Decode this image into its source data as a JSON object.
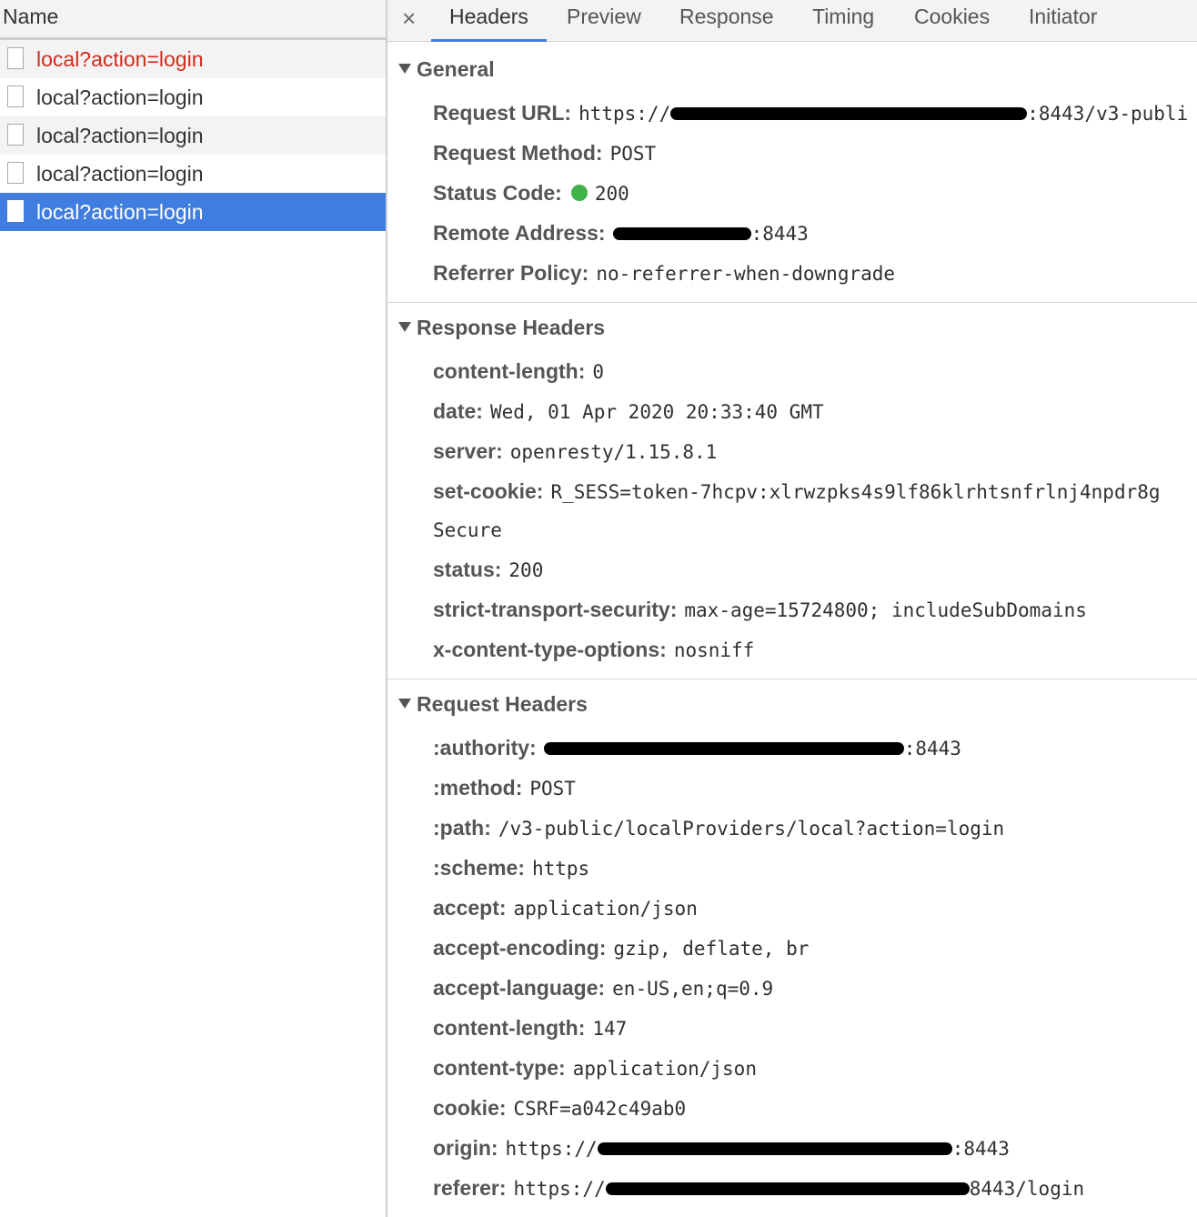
{
  "left_panel": {
    "header": "Name",
    "requests": [
      {
        "label": "local?action=login",
        "state": "error"
      },
      {
        "label": "local?action=login",
        "state": "normal"
      },
      {
        "label": "local?action=login",
        "state": "normal"
      },
      {
        "label": "local?action=login",
        "state": "normal"
      },
      {
        "label": "local?action=login",
        "state": "selected"
      }
    ]
  },
  "tabs": {
    "close": "×",
    "items": [
      "Headers",
      "Preview",
      "Response",
      "Timing",
      "Cookies",
      "Initiator"
    ],
    "active": "Headers"
  },
  "general": {
    "title": "General",
    "request_url_key": "Request URL:",
    "request_url_prefix": "https://",
    "request_url_suffix": ":8443/v3-publi",
    "request_method_key": "Request Method:",
    "request_method": "POST",
    "status_code_key": "Status Code:",
    "status_code": "200",
    "remote_address_key": "Remote Address:",
    "remote_address_suffix": ":8443",
    "referrer_policy_key": "Referrer Policy:",
    "referrer_policy": "no-referrer-when-downgrade"
  },
  "response_headers": {
    "title": "Response Headers",
    "content_length_key": "content-length:",
    "content_length": "0",
    "date_key": "date:",
    "date": "Wed, 01 Apr 2020 20:33:40 GMT",
    "server_key": "server:",
    "server": "openresty/1.15.8.1",
    "set_cookie_key": "set-cookie:",
    "set_cookie": "R_SESS=token-7hcpv:xlrwzpks4s9lf86klrhtsnfrlnj4npdr8g",
    "set_cookie_cont": "Secure",
    "status_key": "status:",
    "status": "200",
    "sts_key": "strict-transport-security:",
    "sts": "max-age=15724800; includeSubDomains",
    "xcto_key": "x-content-type-options:",
    "xcto": "nosniff"
  },
  "request_headers": {
    "title": "Request Headers",
    "authority_key": ":authority:",
    "authority_suffix": ":8443",
    "method_key": ":method:",
    "method": "POST",
    "path_key": ":path:",
    "path": "/v3-public/localProviders/local?action=login",
    "scheme_key": ":scheme:",
    "scheme": "https",
    "accept_key": "accept:",
    "accept": "application/json",
    "accept_encoding_key": "accept-encoding:",
    "accept_encoding": "gzip, deflate, br",
    "accept_language_key": "accept-language:",
    "accept_language": "en-US,en;q=0.9",
    "content_length_key": "content-length:",
    "content_length": "147",
    "content_type_key": "content-type:",
    "content_type": "application/json",
    "cookie_key": "cookie:",
    "cookie": "CSRF=a042c49ab0",
    "origin_key": "origin:",
    "origin_prefix": "https://",
    "origin_suffix": ":8443",
    "referer_key": "referer:",
    "referer_prefix": "https://",
    "referer_suffix": "8443/login"
  },
  "colors": {
    "selected_row": "#3f7ee0",
    "error_text": "#d22b1e",
    "status_ok": "#3fb24a"
  }
}
